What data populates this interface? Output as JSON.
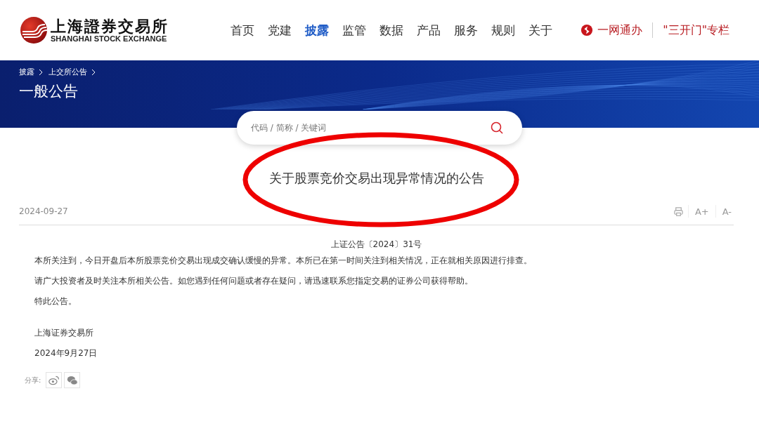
{
  "logo": {
    "name_cn": "上海證券交易所",
    "name_en": "SHANGHAI STOCK EXCHANGE"
  },
  "nav": [
    {
      "label": "首页",
      "selected": false
    },
    {
      "label": "党建",
      "selected": false
    },
    {
      "label": "披露",
      "selected": true
    },
    {
      "label": "监管",
      "selected": false
    },
    {
      "label": "数据",
      "selected": false
    },
    {
      "label": "产品",
      "selected": false
    },
    {
      "label": "服务",
      "selected": false
    },
    {
      "label": "规则",
      "selected": false
    },
    {
      "label": "关于",
      "selected": false
    }
  ],
  "header_links": [
    "一网通办",
    "\"三开门\"专栏"
  ],
  "breadcrumb": [
    "披露",
    "上交所公告"
  ],
  "page_title": "一般公告",
  "search": {
    "placeholder": "代码 / 简称 / 关键词"
  },
  "article": {
    "title": "关于股票竞价交易出现异常情况的公告",
    "date": "2024-09-27",
    "tools": [
      "A+",
      "A-"
    ],
    "doc_number": "上证公告〔2024〕31号",
    "paragraphs": [
      "本所关注到，今日开盘后本所股票竞价交易出现成交确认缓慢的异常。本所已在第一时间关注到相关情况，正在就相关原因进行排查。",
      "请广大投资者及时关注本所相关公告。如您遇到任何问题或者存在疑问，请迅速联系您指定交易的证券公司获得帮助。",
      "特此公告。"
    ],
    "signature": [
      "上海证券交易所",
      "2024年9月27日"
    ],
    "share_label": "分享:"
  }
}
